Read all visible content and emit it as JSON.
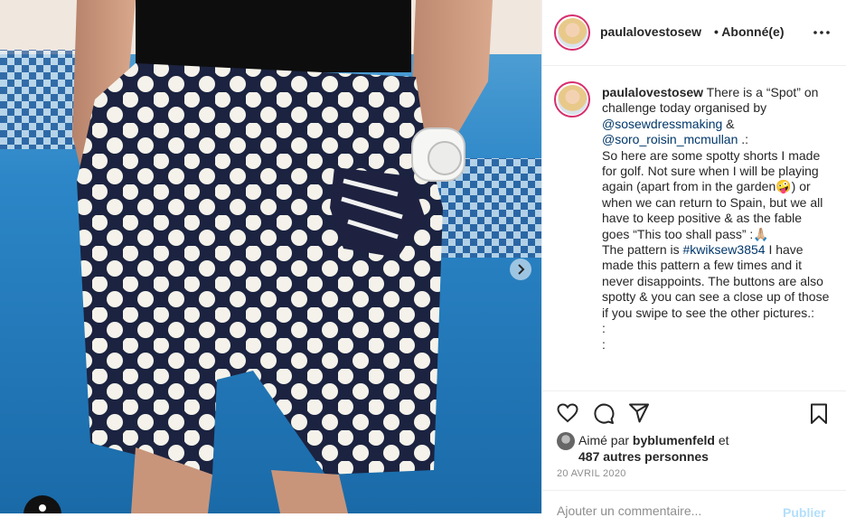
{
  "post": {
    "username": "paulalovestosew",
    "follow_separator": "•",
    "follow_status": "Abonné(e)",
    "caption": {
      "intro": " There is a “Spot” on challenge today organised by ",
      "mention_1": "@sosewdressmaking",
      "amp": " & ",
      "mention_2": "@soro_roisin_mcmullan",
      "body_1": " .:\nSo here are some spotty shorts I made for golf. Not sure when I will be playing again (apart from in the garden🤪) or when we can return to Spain, but we all have to keep positive & as the fable goes “This too shall pass” :🙏🏼\nThe pattern is ",
      "hashtag": "#kwiksew3854",
      "body_2": " I have made this pattern a few times and it never disappoints. The buttons are also spotty & you can see a close up of those if you swipe to see the other pictures.:\n:\n:"
    },
    "likes": {
      "prefix": "Aimé par ",
      "liker": "byblumenfeld",
      "mid": " et",
      "others": "487 autres personnes"
    },
    "date": "20 AVRIL 2020",
    "comment": {
      "placeholder": "Ajouter un commentaire...",
      "publish_label": "Publier"
    }
  },
  "icons": {
    "like": "heart-icon",
    "comment": "comment-icon",
    "share": "paper-plane-icon",
    "save": "bookmark-icon",
    "more": "more-dots-icon",
    "next": "chevron-right-icon"
  },
  "colors": {
    "story_ring": "#d62f6e",
    "link": "#00376b",
    "muted": "#8e8e8e",
    "publish_disabled": "#b2dffc",
    "shorts_navy": "#1b2340"
  }
}
